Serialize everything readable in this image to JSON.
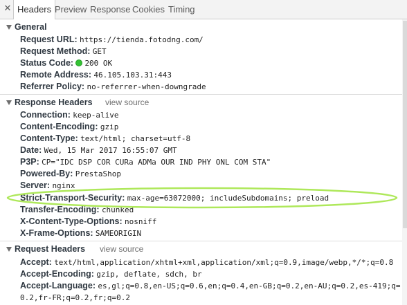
{
  "tabs": {
    "close_glyph": "✕",
    "items": [
      "Headers",
      "Preview",
      "Response",
      "Cookies",
      "Timing"
    ],
    "active": "Headers"
  },
  "general": {
    "title": "General",
    "rows": [
      {
        "key": "Request URL:",
        "value": "https://tienda.fotodng.com/"
      },
      {
        "key": "Request Method:",
        "value": "GET"
      },
      {
        "key": "Status Code:",
        "value": "200 OK"
      },
      {
        "key": "Remote Address:",
        "value": "46.105.103.31:443"
      },
      {
        "key": "Referrer Policy:",
        "value": "no-referrer-when-downgrade"
      }
    ]
  },
  "response_headers": {
    "title": "Response Headers",
    "view_source": "view source",
    "rows": [
      {
        "key": "Connection:",
        "value": "keep-alive"
      },
      {
        "key": "Content-Encoding:",
        "value": "gzip"
      },
      {
        "key": "Content-Type:",
        "value": "text/html; charset=utf-8"
      },
      {
        "key": "Date:",
        "value": "Wed, 15 Mar 2017 16:55:07 GMT"
      },
      {
        "key": "P3P:",
        "value": "CP=\"IDC DSP COR CURa ADMa OUR IND PHY ONL COM STA\""
      },
      {
        "key": "Powered-By:",
        "value": "PrestaShop"
      },
      {
        "key": "Server:",
        "value": "nginx"
      },
      {
        "key": "Strict-Transport-Security:",
        "value": "max-age=63072000; includeSubdomains; preload"
      },
      {
        "key": "Transfer-Encoding:",
        "value": "chunked"
      },
      {
        "key": "X-Content-Type-Options:",
        "value": "nosniff"
      },
      {
        "key": "X-Frame-Options:",
        "value": "SAMEORIGIN"
      }
    ]
  },
  "request_headers": {
    "title": "Request Headers",
    "view_source": "view source",
    "rows": [
      {
        "key": "Accept:",
        "value": "text/html,application/xhtml+xml,application/xml;q=0.9,image/webp,*/*;q=0.8"
      },
      {
        "key": "Accept-Encoding:",
        "value": "gzip, deflate, sdch, br"
      },
      {
        "key": "Accept-Language:",
        "value": "es,gl;q=0.8,en-US;q=0.6,en;q=0.4,en-GB;q=0.2,en-AU;q=0.2,es-419;q="
      },
      {
        "key": "",
        "value": "0.2,fr-FR;q=0.2,fr;q=0.2"
      }
    ]
  },
  "colors": {
    "highlight": "#aee85a",
    "status_ok": "#34c234"
  },
  "icons": {
    "expand": "triangle-down-icon",
    "status": "status-dot-icon",
    "close": "close-icon"
  }
}
